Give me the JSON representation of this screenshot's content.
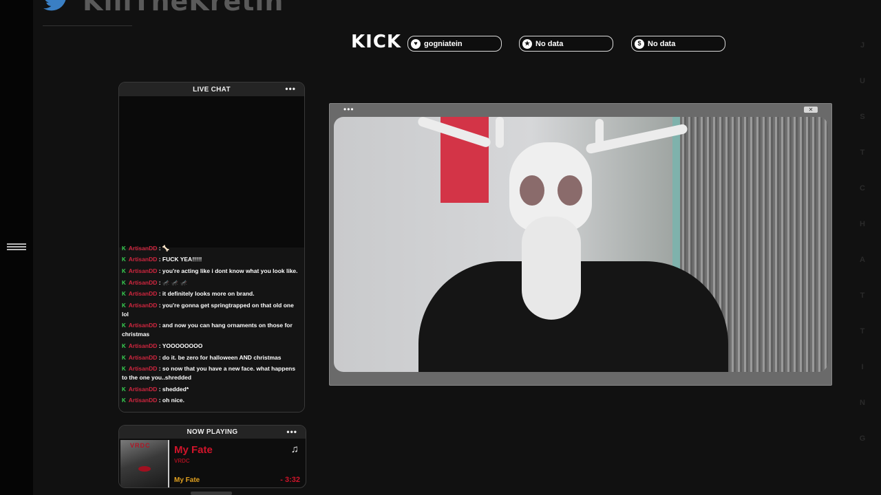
{
  "brand": {
    "name": "KillTheKretin",
    "icon": "twitter-bird-icon"
  },
  "platform": {
    "logo_text": "KICK"
  },
  "stats": [
    {
      "icon": "heart-icon",
      "glyph": "♥",
      "label": "gogniatein"
    },
    {
      "icon": "star-icon",
      "glyph": "★",
      "label": "No data"
    },
    {
      "icon": "dollar-icon",
      "glyph": "$",
      "label": "No data"
    }
  ],
  "chat": {
    "title": "LIVE CHAT",
    "menu": "•••",
    "messages": [
      {
        "user": "ArtisanDD",
        "text": "🦴"
      },
      {
        "user": "ArtisanDD",
        "text": "FUCK YEA!!!!!"
      },
      {
        "user": "ArtisanDD",
        "text": "you're acting like i dont know what you look like."
      },
      {
        "user": "ArtisanDD",
        "text": "🦟 🦟 🦟"
      },
      {
        "user": "ArtisanDD",
        "text": "it definitely looks more on brand."
      },
      {
        "user": "ArtisanDD",
        "text": "you're gonna get springtrapped on that old one lol"
      },
      {
        "user": "ArtisanDD",
        "text": "and now you can hang ornaments on those for christmas"
      },
      {
        "user": "ArtisanDD",
        "text": "YOOOOOOOO"
      },
      {
        "user": "ArtisanDD",
        "text": "do it. be zero for halloween AND christmas"
      },
      {
        "user": "ArtisanDD",
        "text": "so now that you have a new face. what happens to the one you..shredded"
      },
      {
        "user": "ArtisanDD",
        "text": "shedded*"
      },
      {
        "user": "ArtisanDD",
        "text": "oh nice."
      }
    ]
  },
  "now_playing": {
    "title": "NOW PLAYING",
    "menu": "•••",
    "track": "My Fate",
    "artist": "VRDC",
    "album": "My Fate",
    "time": "- 3:32",
    "art_text": "VRDC"
  },
  "video": {
    "menu": "•••",
    "close": "✕"
  },
  "side_letters": [
    "J",
    "U",
    "S",
    "T",
    "C",
    "H",
    "A",
    "T",
    "T",
    "I",
    "N",
    "G"
  ],
  "colors": {
    "accent_red": "#d1263f",
    "kick_green": "#39d353",
    "track_gold": "#e0a020"
  }
}
